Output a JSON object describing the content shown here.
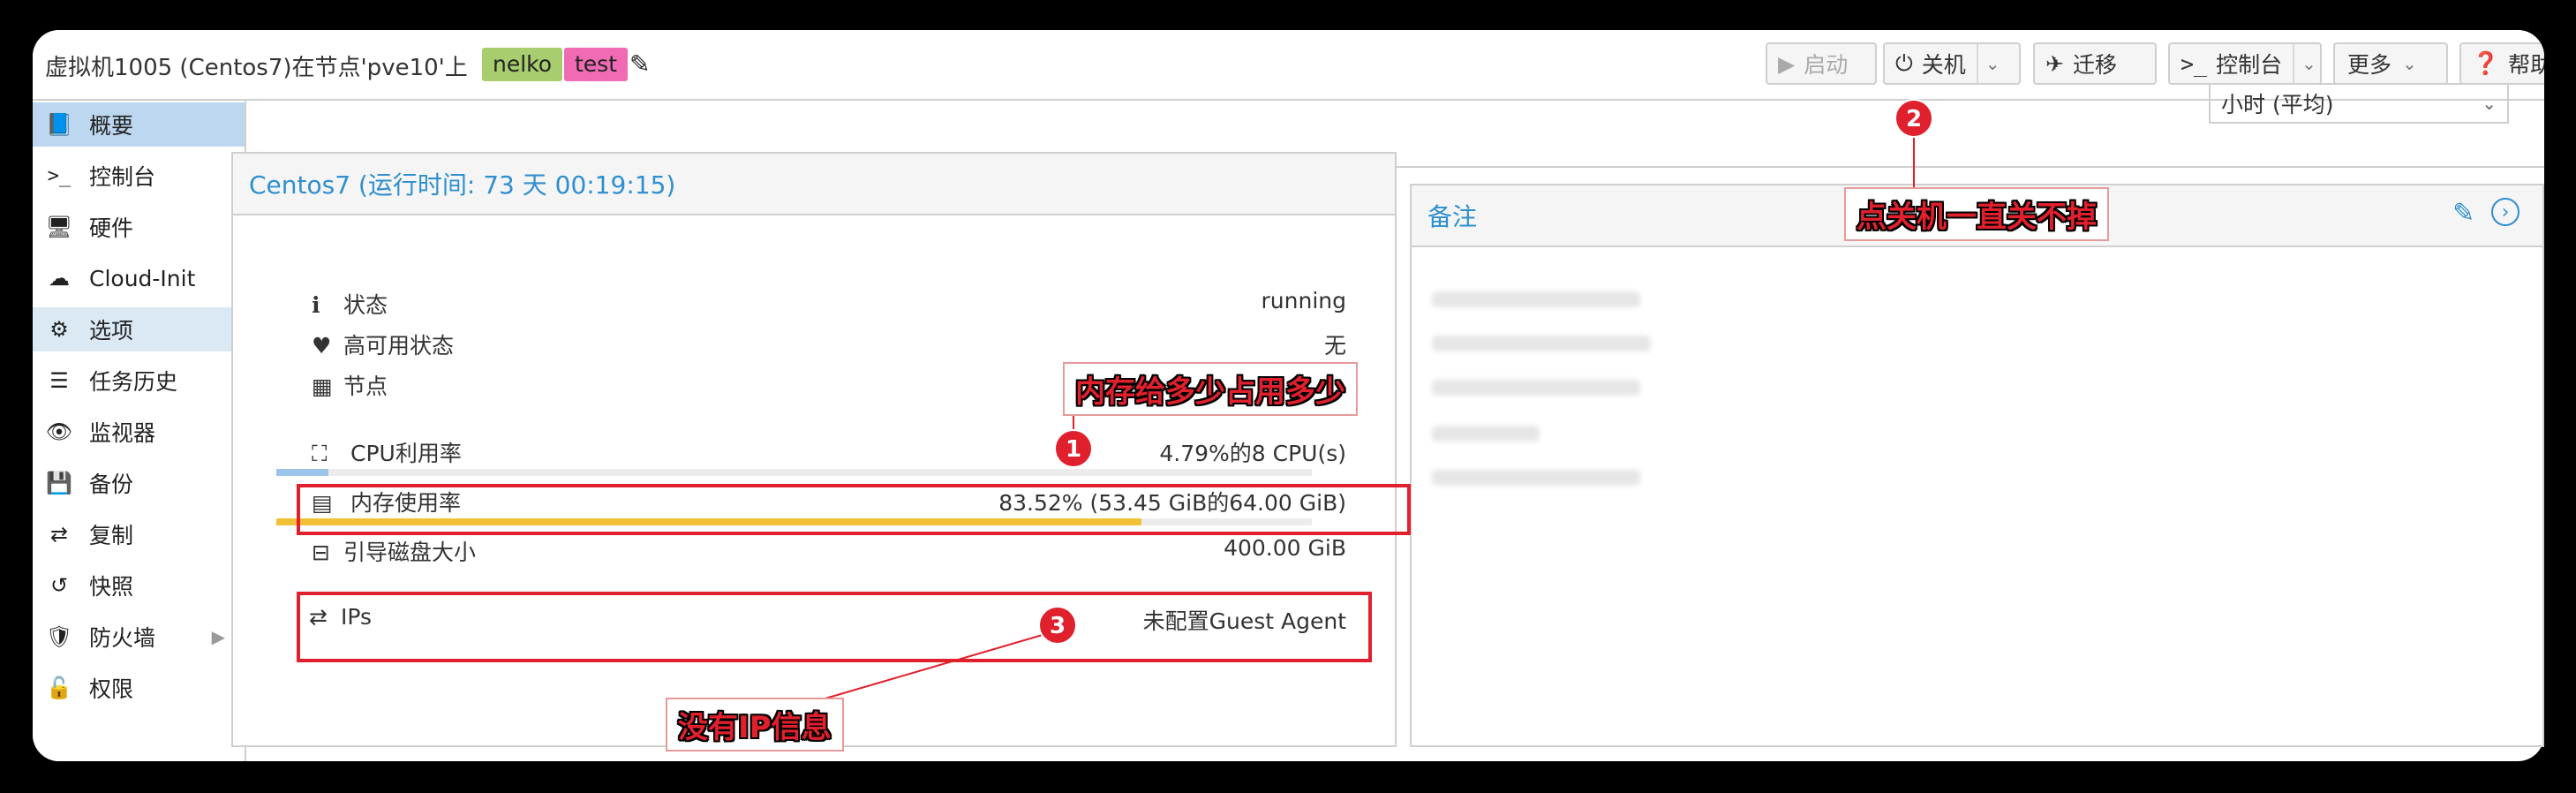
{
  "header": {
    "title": "虚拟机1005 (Centos7)在节点'pve10'上",
    "tags": [
      "nelko",
      "test"
    ],
    "buttons": {
      "start": "启动",
      "shutdown": "关机",
      "migrate": "迁移",
      "console": "控制台",
      "more": "更多",
      "help": "帮助"
    }
  },
  "sidebar": {
    "items": [
      {
        "label": "概要",
        "icon": "book-icon"
      },
      {
        "label": "控制台",
        "icon": "terminal-icon"
      },
      {
        "label": "硬件",
        "icon": "monitor-icon"
      },
      {
        "label": "Cloud-Init",
        "icon": "cloud-icon"
      },
      {
        "label": "选项",
        "icon": "gear-icon"
      },
      {
        "label": "任务历史",
        "icon": "list-icon"
      },
      {
        "label": "监视器",
        "icon": "eye-icon"
      },
      {
        "label": "备份",
        "icon": "floppy-icon"
      },
      {
        "label": "复制",
        "icon": "retweet-icon"
      },
      {
        "label": "快照",
        "icon": "history-icon"
      },
      {
        "label": "防火墙",
        "icon": "shield-icon"
      },
      {
        "label": "权限",
        "icon": "unlock-icon"
      }
    ]
  },
  "timeframe": {
    "selected": "小时 (平均)"
  },
  "summary": {
    "title": "Centos7 (运行时间: 73 天 00:19:15)",
    "status_label": "状态",
    "status_value": "running",
    "ha_label": "高可用状态",
    "ha_value": "无",
    "node_label": "节点",
    "cpu_label": "CPU利用率",
    "cpu_value": "4.79%的8 CPU(s)",
    "cpu_fraction": 0.0479,
    "mem_label": "内存使用率",
    "mem_value": "83.52% (53.45 GiB的64.00 GiB)",
    "mem_fraction": 0.8352,
    "disk_label": "引导磁盘大小",
    "disk_value": "400.00 GiB",
    "ips_label": "IPs",
    "ips_value": "未配置Guest Agent"
  },
  "notes": {
    "title": "备注"
  },
  "annotations": {
    "n1": "1",
    "n2": "2",
    "n3": "3",
    "c1": "内存给多少占用多少",
    "c2": "点关机一直关不掉",
    "c3": "没有IP信息"
  },
  "colors": {
    "accent": "#2f8fcf",
    "tag_nelko": "#a7cd6e",
    "tag_test": "#f06ab4",
    "mem_bar": "#f2c037",
    "cpu_bar": "#9cc4ea",
    "annotation_red": "#e0202c"
  }
}
